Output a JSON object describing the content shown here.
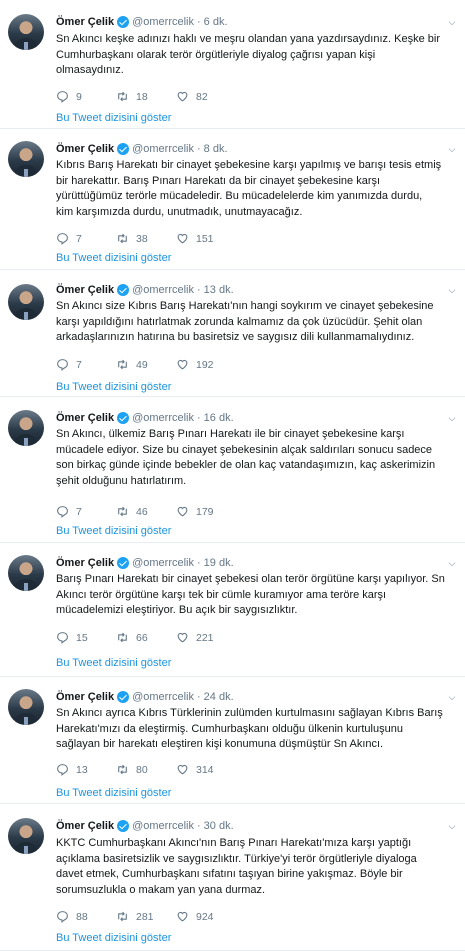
{
  "tweets": [
    {
      "name": "Ömer Çelik",
      "handle": "@omerrcelik",
      "time": "6 dk.",
      "lines": [
        "Sn Akıncı keşke adınızı haklı ve meşru olandan yana yazdırsaydınız. Keşke bir",
        "Cumhurbaşkanı olarak terör örgütleriyle diyalog çağrısı yapan kişi",
        "olmasaydınız."
      ],
      "replies": "9",
      "retweets": "18",
      "likes": "82",
      "thread_link": "Bu Tweet dizisini göster"
    },
    {
      "name": "Ömer Çelik",
      "handle": "@omerrcelik",
      "time": "8 dk.",
      "lines": [
        "Kıbrıs Barış Harekatı bir cinayet şebekesine karşı yapılmış ve barışı tesis etmiş",
        "bir harekattır. Barış Pınarı Harekatı da bir cinayet şebekesine karşı",
        "yürüttüğümüz terörle mücadeledir. Bu mücadelelerde kim yanımızda durdu,",
        "kim karşımızda durdu, unutmadık, unutmayacağız."
      ],
      "replies": "7",
      "retweets": "38",
      "likes": "151",
      "thread_link": "Bu Tweet dizisini göster"
    },
    {
      "name": "Ömer Çelik",
      "handle": "@omerrcelik",
      "time": "13 dk.",
      "lines": [
        "Sn Akıncı size Kıbrıs Barış Harekatı'nın hangi soykırım ve cinayet şebekesine",
        "karşı yapıldığını hatırlatmak zorunda kalmamız da çok üzücüdür. Şehit olan",
        "arkadaşlarınızın hatırına bu basiretsiz ve saygısız dili kullanmamalıydınız."
      ],
      "replies": "7",
      "retweets": "49",
      "likes": "192",
      "thread_link": "Bu Tweet dizisini göster"
    },
    {
      "name": "Ömer Çelik",
      "handle": "@omerrcelik",
      "time": "16 dk.",
      "lines": [
        "Sn Akıncı, ülkemiz Barış Pınarı Harekatı ile bir cinayet şebekesine karşı",
        "mücadele ediyor. Size bu cinayet şebekesinin alçak saldırıları sonucu sadece",
        "son birkaç günde içinde bebekler de olan kaç vatandaşımızın, kaç askerimizin",
        "şehit olduğunu hatırlatırım."
      ],
      "replies": "7",
      "retweets": "46",
      "likes": "179",
      "thread_link": "Bu Tweet dizisini göster"
    },
    {
      "name": "Ömer Çelik",
      "handle": "@omerrcelik",
      "time": "19 dk.",
      "lines": [
        "Barış Pınarı Harekatı bir cinayet şebekesi olan terör örgütüne karşı yapılıyor. Sn",
        "Akıncı terör örgütüne karşı tek bir cümle kuramıyor ama teröre karşı",
        "mücadelemizi eleştiriyor. Bu açık bir saygısızlıktır."
      ],
      "replies": "15",
      "retweets": "66",
      "likes": "221",
      "thread_link": "Bu Tweet dizisini göster"
    },
    {
      "name": "Ömer Çelik",
      "handle": "@omerrcelik",
      "time": "24 dk.",
      "lines": [
        "Sn Akıncı ayrıca Kıbrıs Türklerinin zulümden kurtulmasını sağlayan Kıbrıs Barış",
        "Harekatı'mızı da eleştirmiş. Cumhurbaşkanı olduğu ülkenin kurtuluşunu",
        "sağlayan bir harekatı eleştiren kişi konumuna düşmüştür Sn Akıncı."
      ],
      "replies": "13",
      "retweets": "80",
      "likes": "314",
      "thread_link": "Bu Tweet dizisini göster"
    },
    {
      "name": "Ömer Çelik",
      "handle": "@omerrcelik",
      "time": "30 dk.",
      "lines": [
        "KKTC Cumhurbaşkanı Akıncı'nın Barış Pınarı Harekatı'mıza karşı yaptığı",
        "açıklama basiretsizlik ve saygısızlıktır. Türkiye'yi terör örgütleriyle diyaloga",
        "davet etmek, Cumhurbaşkanı sıfatını taşıyan birine yakışmaz. Böyle bir",
        "sorumsuzlukla o makam yan yana durmaz."
      ],
      "replies": "88",
      "retweets": "281",
      "likes": "924",
      "thread_link": "Bu Tweet dizisini göster"
    }
  ],
  "colors": {
    "accent": "#1b95e0",
    "verified": "#1da1f2",
    "muted": "#657786",
    "divider": "#e6ecf0"
  },
  "icons": [
    "verified-badge-icon",
    "chevron-down-icon",
    "reply-icon",
    "retweet-icon",
    "like-icon"
  ]
}
